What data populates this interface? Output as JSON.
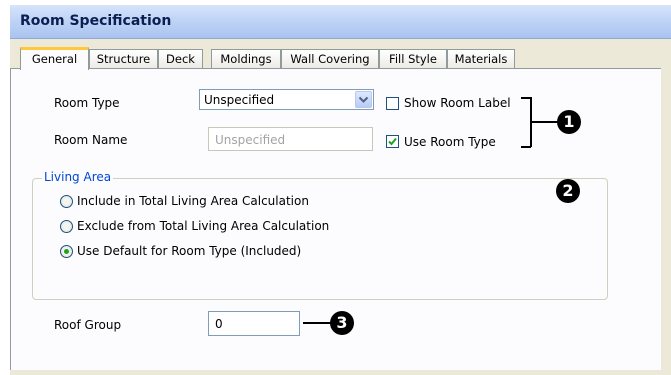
{
  "window": {
    "title": "Room Specification"
  },
  "tabs": [
    {
      "label": "General",
      "active": true
    },
    {
      "label": "Structure"
    },
    {
      "label": "Deck"
    },
    {
      "label": "Moldings"
    },
    {
      "label": "Wall Covering"
    },
    {
      "label": "Fill Style"
    },
    {
      "label": "Materials"
    }
  ],
  "general": {
    "room_type_label": "Room Type",
    "room_type_value": "Unspecified",
    "room_name_label": "Room Name",
    "room_name_value": "Unspecified",
    "show_room_label": "Show Room Label",
    "show_room_label_checked": false,
    "use_room_type": "Use Room Type",
    "use_room_type_checked": true,
    "living_area": {
      "title": "Living Area",
      "options": [
        {
          "label": "Include in Total Living Area Calculation",
          "selected": false
        },
        {
          "label": "Exclude from Total Living Area Calculation",
          "selected": false
        },
        {
          "label": "Use Default for Room Type (Included)",
          "selected": true
        }
      ]
    },
    "roof_group_label": "Roof Group",
    "roof_group_value": "0"
  },
  "callouts": [
    "1",
    "2",
    "3"
  ],
  "colors": {
    "group_title": "#0046d5",
    "check_green": "#21a121",
    "tab_highlight": "#ffc73c"
  }
}
